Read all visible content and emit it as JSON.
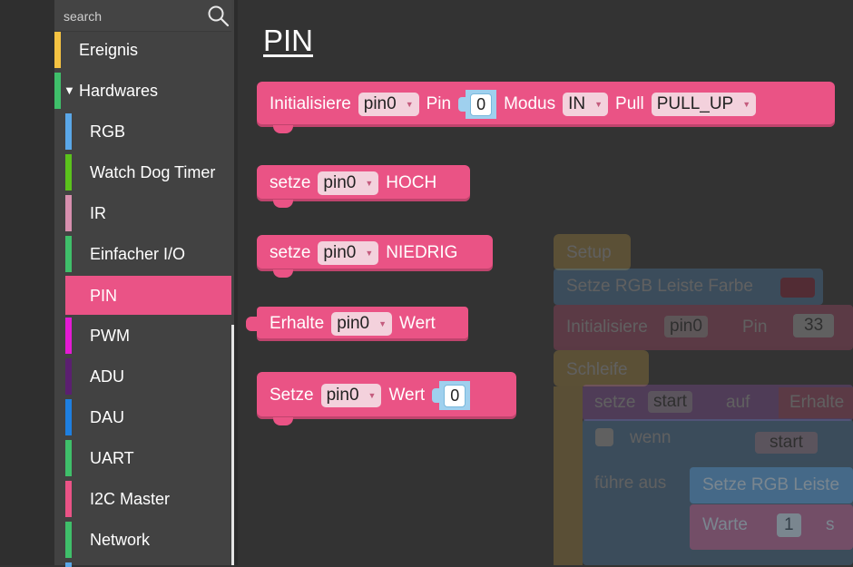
{
  "search": {
    "placeholder": "search"
  },
  "toolbox": {
    "categories": [
      {
        "label": "Ereignis",
        "color": "#f5c342"
      },
      {
        "label": "Hardwares",
        "color": "#3fbf6a",
        "expander": "▼"
      },
      {
        "label": "RGB",
        "color": "#5aa7e8"
      },
      {
        "label": "Watch Dog Timer",
        "color": "#5bc21c"
      },
      {
        "label": "IR",
        "color": "#d78fae"
      },
      {
        "label": "Einfacher I/O",
        "color": "#3fbf6a"
      },
      {
        "label": "PIN",
        "color": "#ea5386",
        "selected": true
      },
      {
        "label": "PWM",
        "color": "#e41bd4"
      },
      {
        "label": "ADU",
        "color": "#5b1f70"
      },
      {
        "label": "DAU",
        "color": "#1e7fe0"
      },
      {
        "label": "UART",
        "color": "#3fbf6a"
      },
      {
        "label": "I2C Master",
        "color": "#ea5386"
      },
      {
        "label": "Network",
        "color": "#3fbf6a"
      }
    ]
  },
  "workspace": {
    "title": "PIN",
    "blocks": {
      "init": {
        "text1": "Initialisiere",
        "pin": "pin0",
        "text2": "Pin",
        "value": "0",
        "text3": "Modus",
        "mode": "IN",
        "text4": "Pull",
        "pull": "PULL_UP"
      },
      "set_high": {
        "text1": "setze",
        "pin": "pin0",
        "text2": "HOCH"
      },
      "set_low": {
        "text1": "setze",
        "pin": "pin0",
        "text2": "NIEDRIG"
      },
      "get_value": {
        "text1": "Erhalte",
        "pin": "pin0",
        "text2": "Wert"
      },
      "set_value": {
        "text1": "Setze",
        "pin": "pin0",
        "text2": "Wert",
        "value": "0"
      }
    },
    "background_program": {
      "setup": "Setup",
      "rgb": "Setze RGB Leiste Farbe",
      "init": "Initialisiere",
      "init_pin": "pin0",
      "init_word": "Pin",
      "init_value": "33",
      "loop": "Schleife",
      "set_word": "setze",
      "set_var": "start",
      "set_to": "auf",
      "get_word": "Erhalte",
      "if_word": "wenn",
      "if_var": "start",
      "do_word": "führe aus",
      "rgb2": "Setze RGB Leiste",
      "wait": "Warte",
      "wait_value": "1",
      "wait_unit": "s"
    }
  }
}
